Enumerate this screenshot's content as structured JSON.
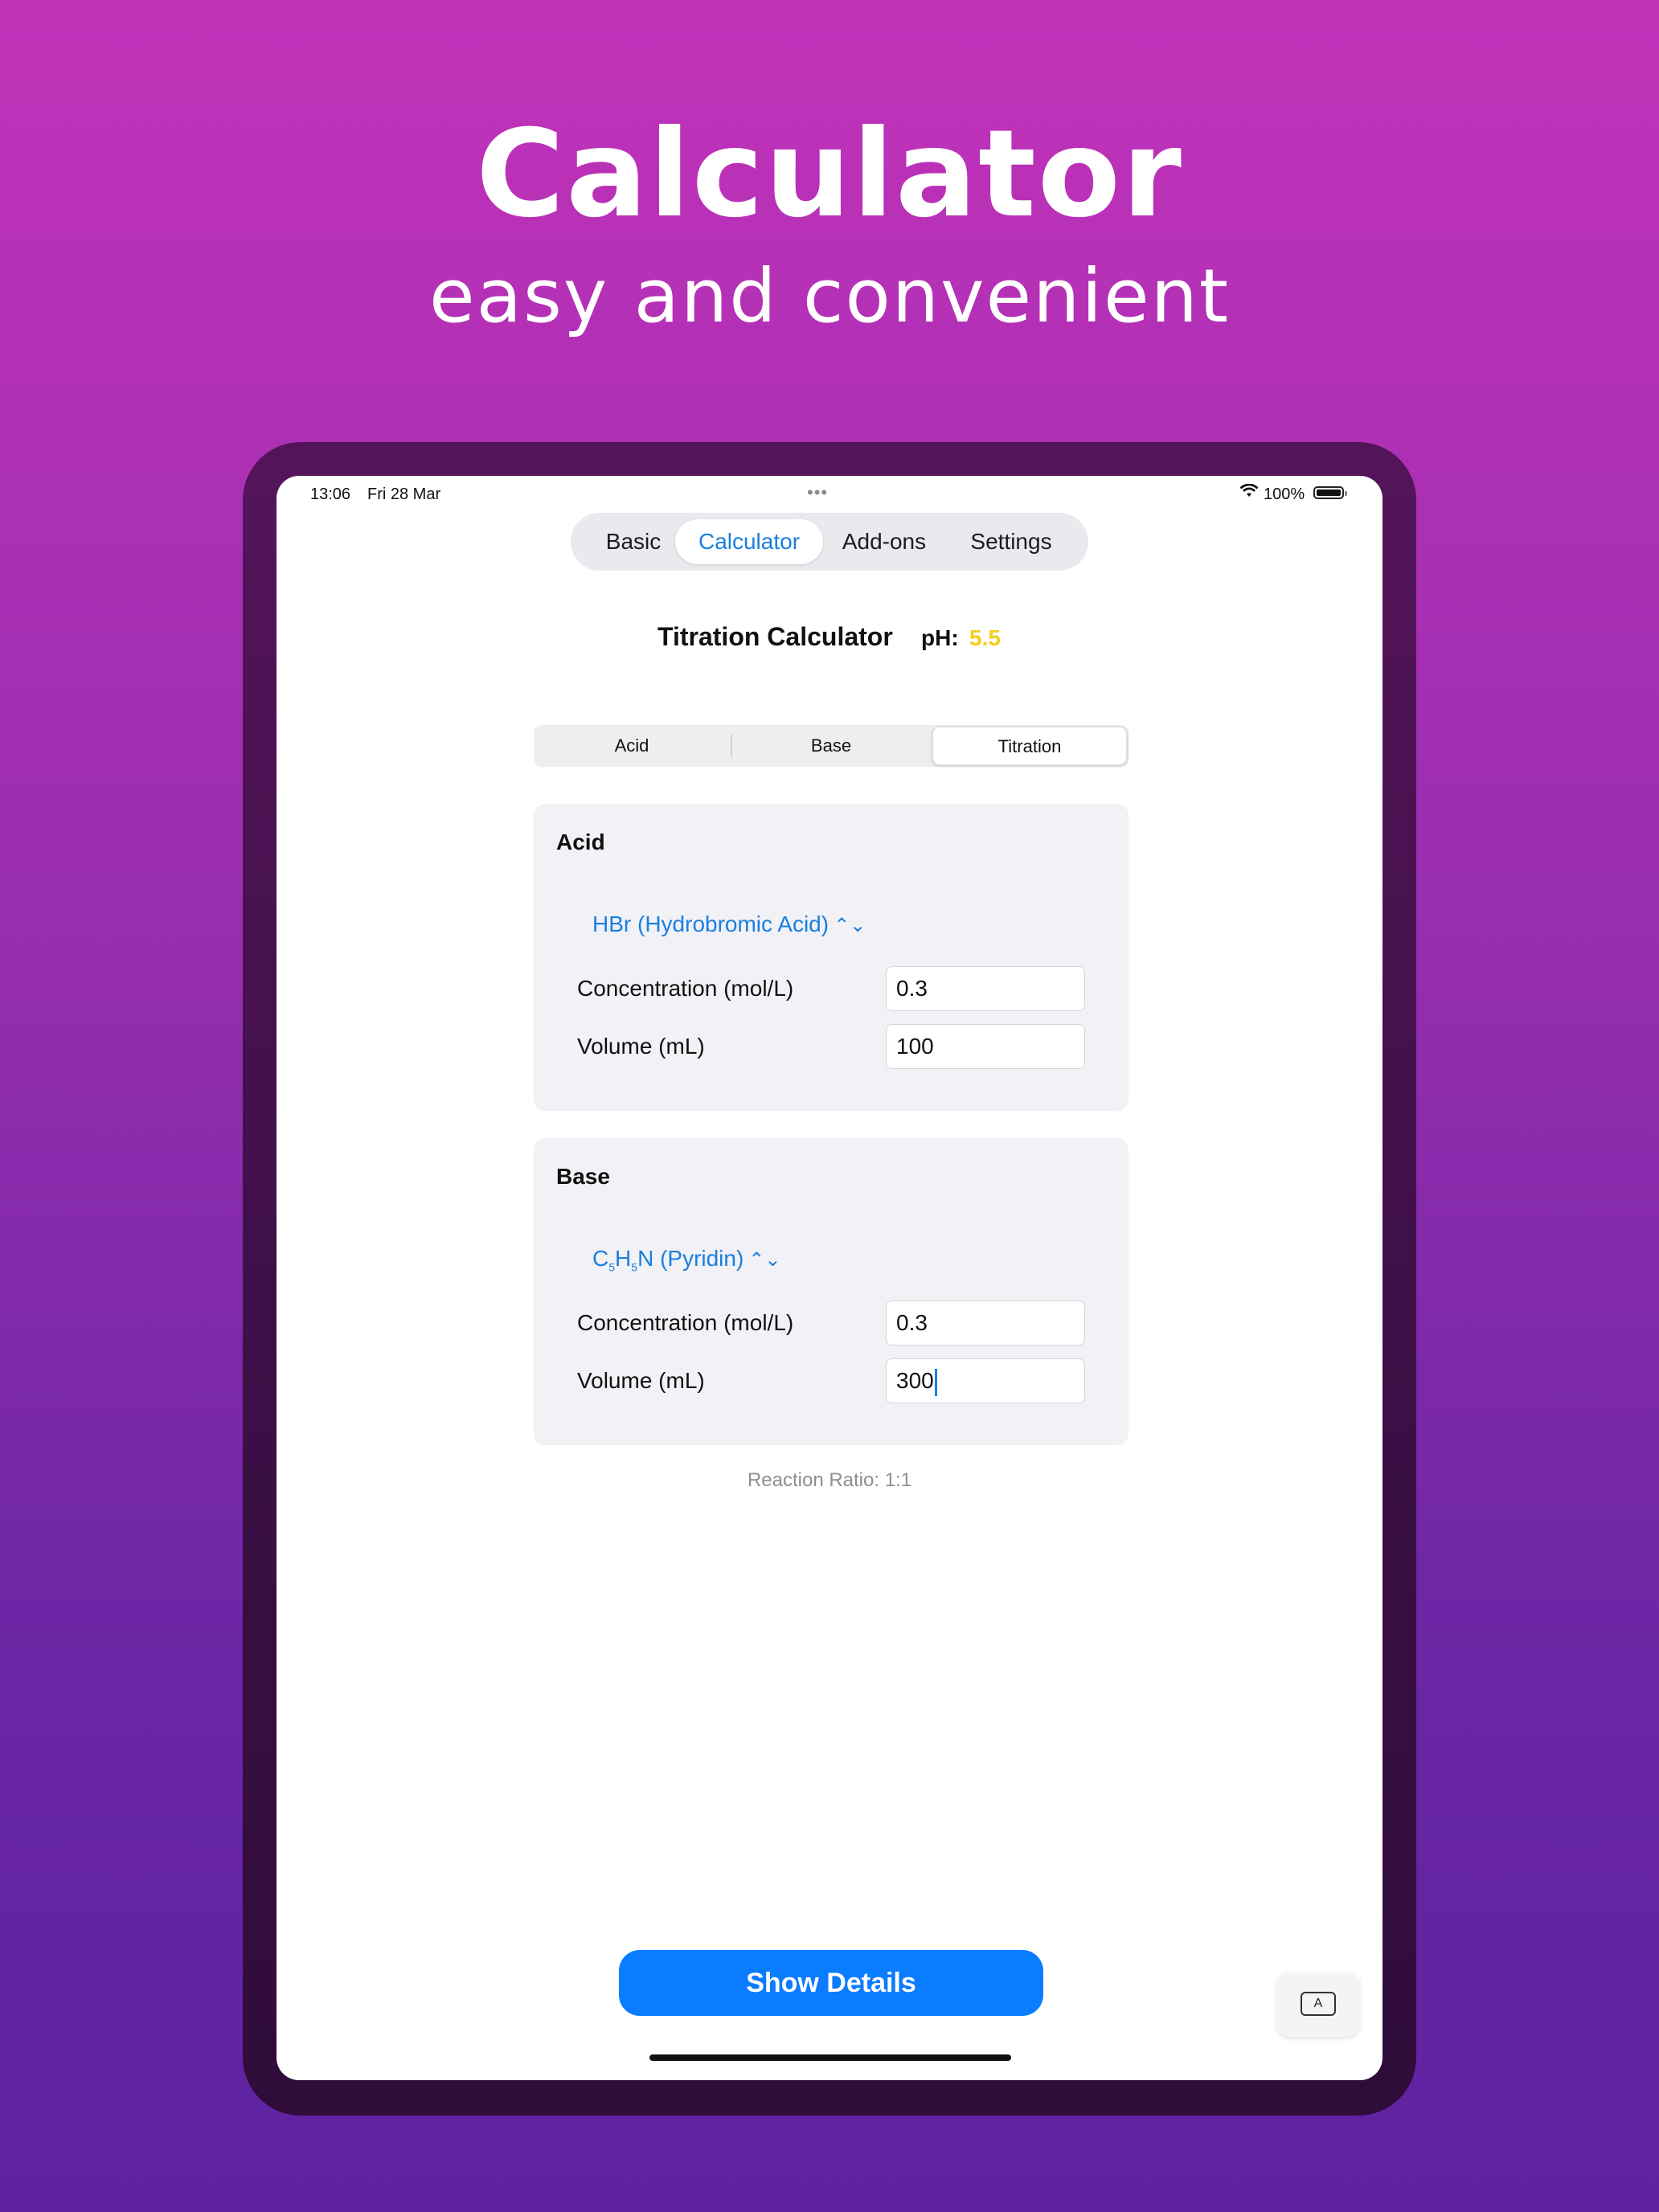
{
  "hero": {
    "title": "Calculator",
    "subtitle": "easy and convenient"
  },
  "status_bar": {
    "time": "13:06",
    "date": "Fri 28 Mar",
    "battery": "100%"
  },
  "tabs": [
    {
      "label": "Basic"
    },
    {
      "label": "Calculator",
      "active": true
    },
    {
      "label": "Add-ons"
    },
    {
      "label": "Settings"
    }
  ],
  "header": {
    "title": "Titration Calculator",
    "ph_label": "pH:",
    "ph_value": "5.5",
    "ph_color": "#f5cf1c"
  },
  "segments": [
    {
      "label": "Acid"
    },
    {
      "label": "Base"
    },
    {
      "label": "Titration",
      "active": true
    }
  ],
  "acid": {
    "title": "Acid",
    "picker": "HBr (Hydrobromic Acid)",
    "concentration_label": "Concentration (mol/L)",
    "concentration": "0.3",
    "volume_label": "Volume (mL)",
    "volume": "100"
  },
  "base": {
    "title": "Base",
    "picker_prefix": "C",
    "picker_sub1": "5",
    "picker_mid": "H",
    "picker_sub2": "5",
    "picker_rest": "N (Pyridin)",
    "concentration_label": "Concentration (mol/L)",
    "concentration": "0.3",
    "volume_label": "Volume (mL)",
    "volume": "300"
  },
  "ratio": "Reaction Ratio: 1:1",
  "show_details": "Show Details",
  "keyboard_key": "A",
  "colors": {
    "accent": "#0a7cff",
    "link": "#1a7fe0"
  }
}
